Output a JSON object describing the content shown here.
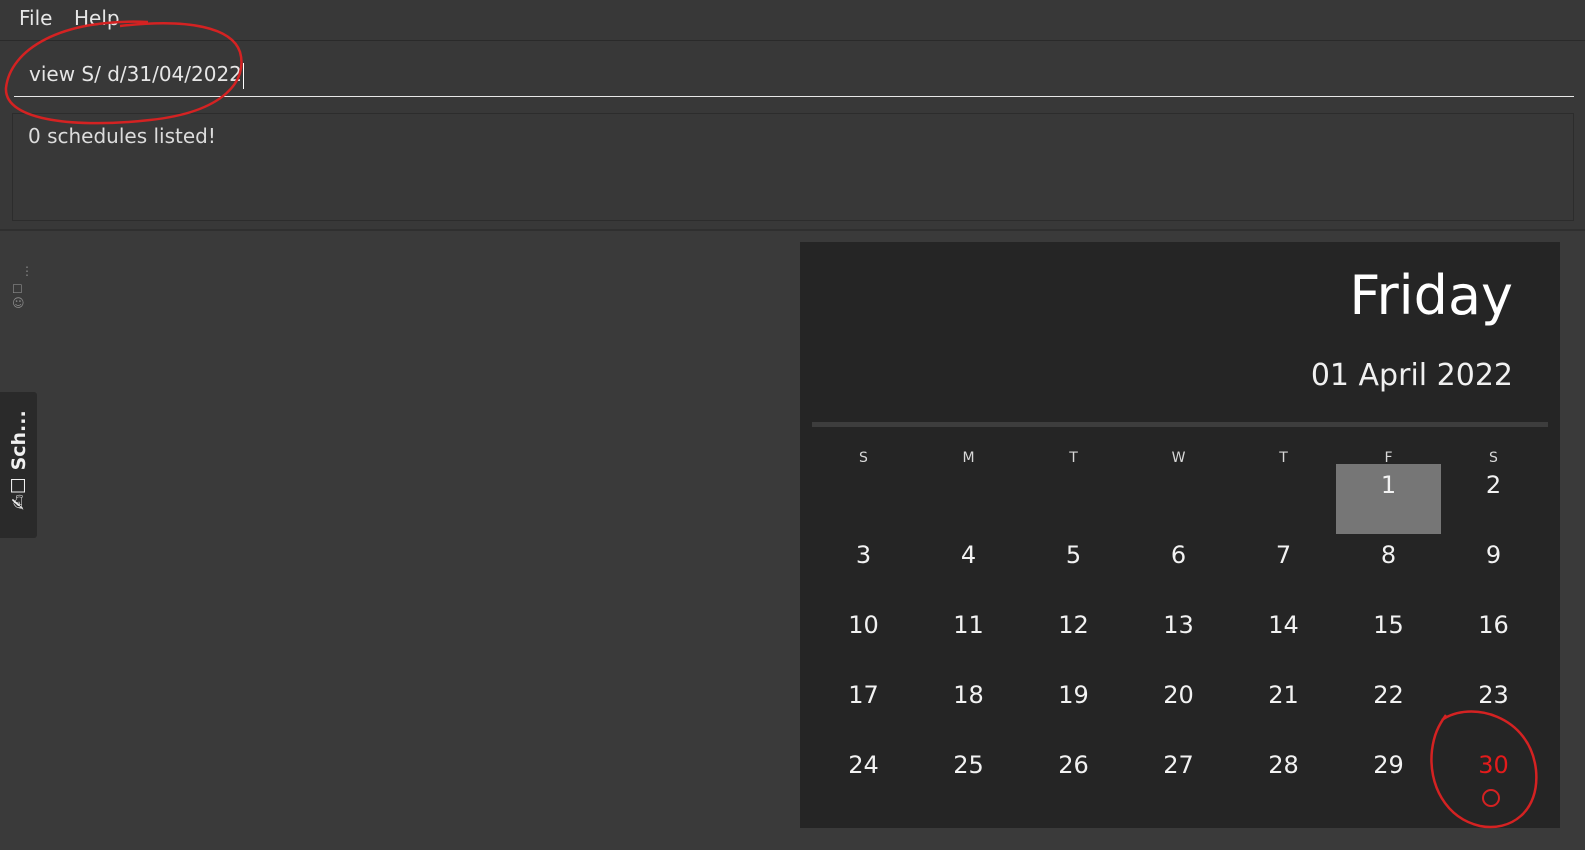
{
  "menu": {
    "file": "File",
    "help": "Help"
  },
  "command": {
    "value": "view S/ d/31/04/2022"
  },
  "result": {
    "message": "0 schedules listed!"
  },
  "side_tab": {
    "label": "✍☐ Sch..."
  },
  "calendar": {
    "day_name": "Friday",
    "date_label": "01 April 2022",
    "weekdays": [
      "S",
      "M",
      "T",
      "W",
      "T",
      "F",
      "S"
    ],
    "weeks": [
      [
        "",
        "",
        "",
        "",
        "",
        "1",
        "2"
      ],
      [
        "3",
        "4",
        "5",
        "6",
        "7",
        "8",
        "9"
      ],
      [
        "10",
        "11",
        "12",
        "13",
        "14",
        "15",
        "16"
      ],
      [
        "17",
        "18",
        "19",
        "20",
        "21",
        "22",
        "23"
      ],
      [
        "24",
        "25",
        "26",
        "27",
        "28",
        "29",
        "30"
      ]
    ],
    "selected_day": "1",
    "highlighted_day": "30",
    "accent_color": "#e41b1b"
  }
}
